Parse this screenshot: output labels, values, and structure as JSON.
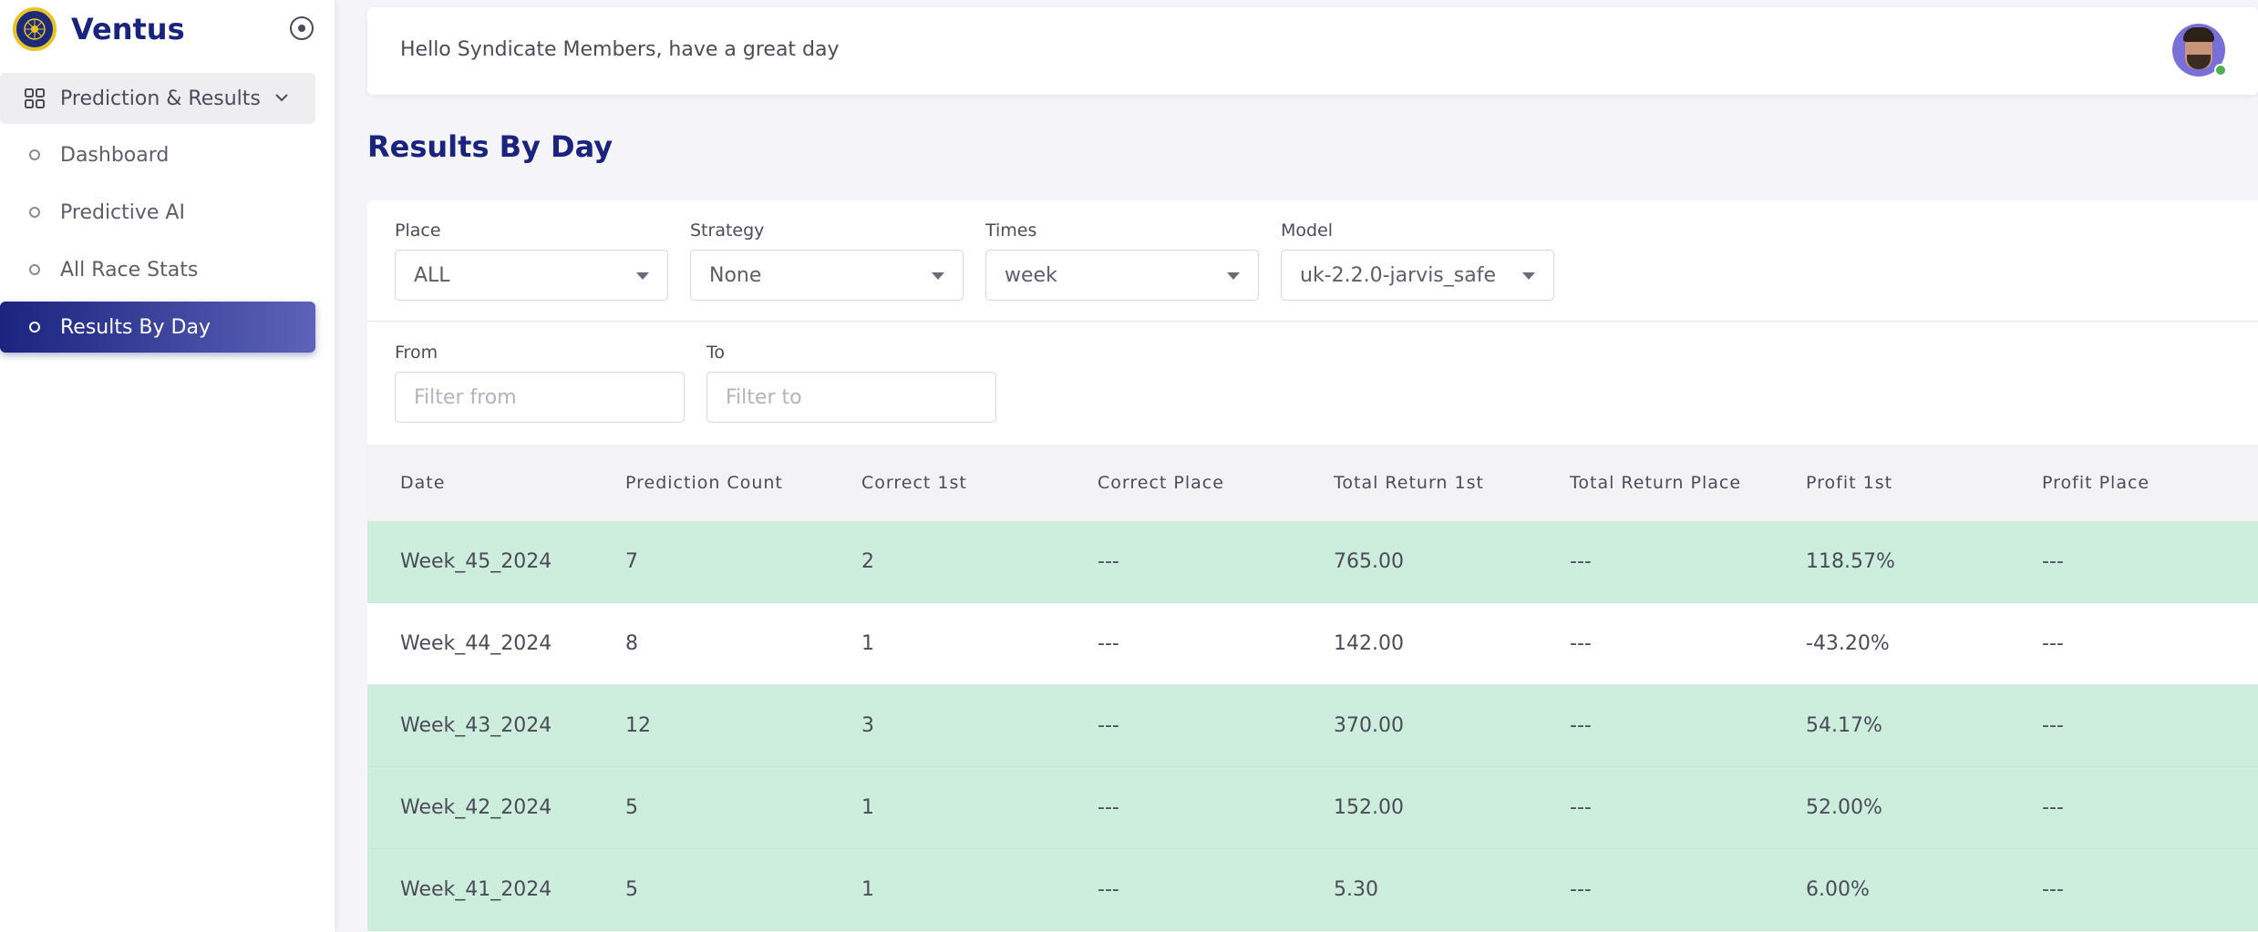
{
  "brand": {
    "name": "Ventus"
  },
  "sidebar": {
    "group": {
      "label": "Prediction & Results"
    },
    "items": [
      {
        "label": "Dashboard"
      },
      {
        "label": "Predictive AI"
      },
      {
        "label": "All Race Stats"
      },
      {
        "label": "Results By Day",
        "active": true
      }
    ]
  },
  "header": {
    "greeting": "Hello Syndicate Members, have a great day"
  },
  "page": {
    "title": "Results By Day"
  },
  "filters": {
    "place": {
      "label": "Place",
      "value": "ALL"
    },
    "strategy": {
      "label": "Strategy",
      "value": "None"
    },
    "times": {
      "label": "Times",
      "value": "week"
    },
    "model": {
      "label": "Model",
      "value": "uk-2.2.0-jarvis_safe"
    },
    "from": {
      "label": "From",
      "placeholder": "Filter from"
    },
    "to": {
      "label": "To",
      "placeholder": "Filter to"
    }
  },
  "table": {
    "columns": [
      "Date",
      "Prediction Count",
      "Correct 1st",
      "Correct Place",
      "Total Return 1st",
      "Total Return Place",
      "Profit 1st",
      "Profit Place"
    ],
    "rows": [
      [
        "Week_45_2024",
        "7",
        "2",
        "---",
        "765.00",
        "---",
        "118.57%",
        "---"
      ],
      [
        "Week_44_2024",
        "8",
        "1",
        "---",
        "142.00",
        "---",
        "-43.20%",
        "---"
      ],
      [
        "Week_43_2024",
        "12",
        "3",
        "---",
        "370.00",
        "---",
        "54.17%",
        "---"
      ],
      [
        "Week_42_2024",
        "5",
        "1",
        "---",
        "152.00",
        "---",
        "52.00%",
        "---"
      ],
      [
        "Week_41_2024",
        "5",
        "1",
        "---",
        "5.30",
        "---",
        "6.00%",
        "---"
      ]
    ]
  },
  "colors": {
    "brand": "#1a237e",
    "profit_row": "#cdeedc",
    "active_gradient_end": "#5c63b8"
  }
}
